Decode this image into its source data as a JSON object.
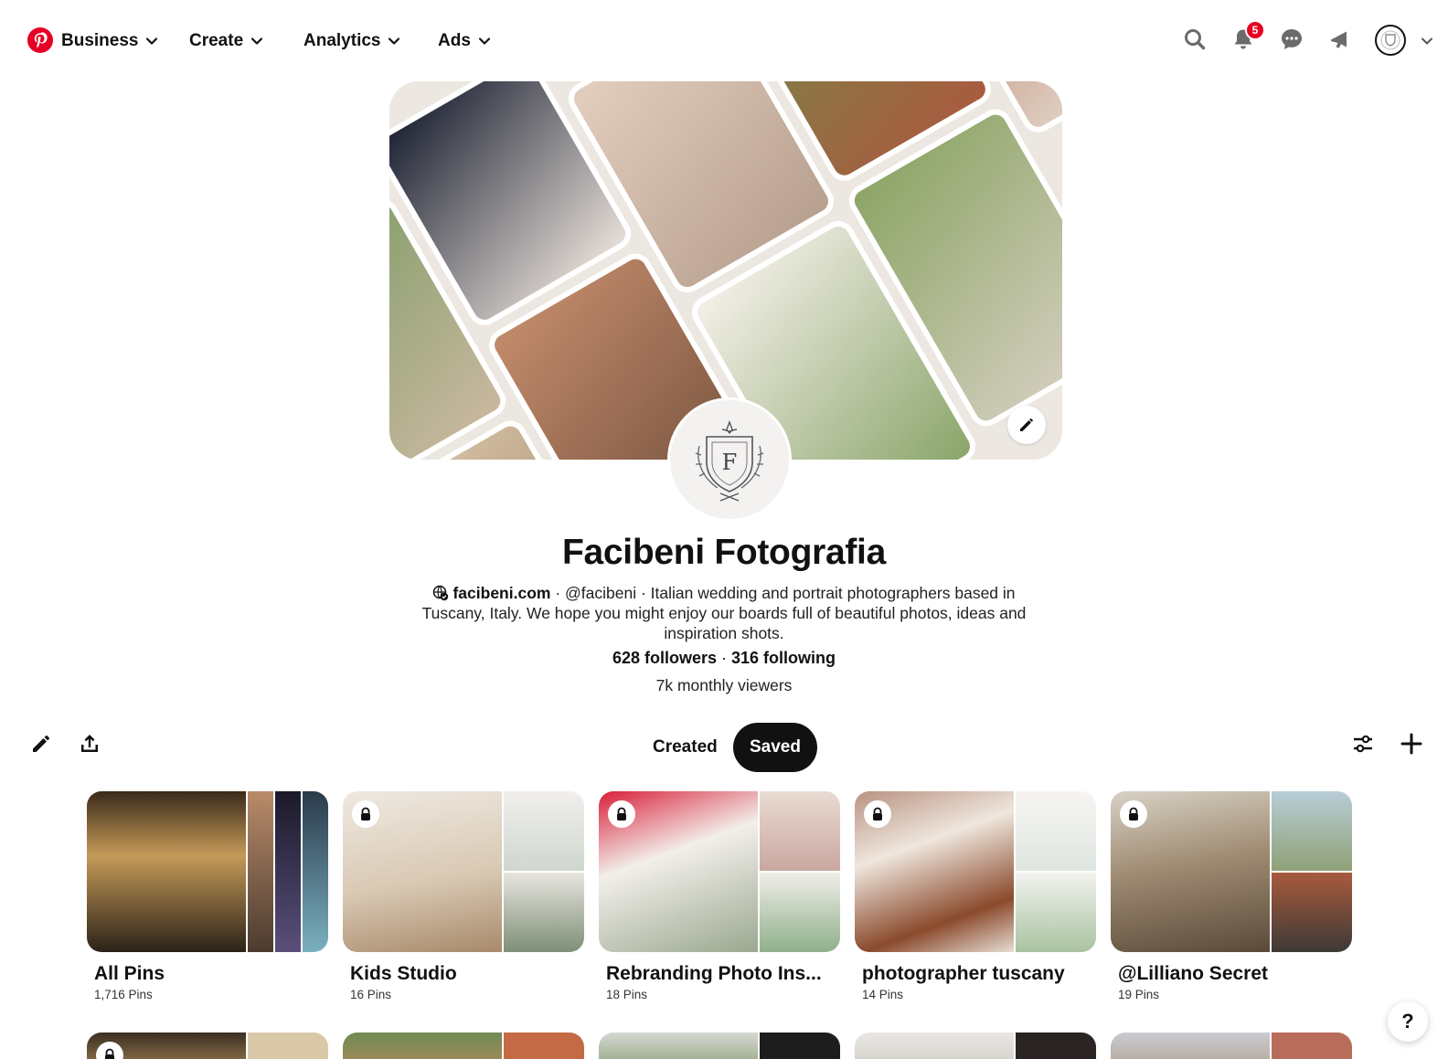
{
  "nav": {
    "items": [
      {
        "label": "Business"
      },
      {
        "label": "Create"
      },
      {
        "label": "Analytics"
      },
      {
        "label": "Ads"
      }
    ],
    "notification_count": "5",
    "brand_color": "#e60023"
  },
  "profile": {
    "name": "Facibeni Fotografia",
    "website": "facibeni.com",
    "bio_rest": " · @facibeni · Italian wedding and portrait photographers based in Tuscany, Italy. We hope you might enjoy our boards full of beautiful photos, ideas and inspiration shots.",
    "followers": "628 followers",
    "following": "316 following",
    "separator": " · ",
    "monthly_viewers": "7k monthly viewers",
    "avatar_letter": "F"
  },
  "tabs": {
    "created": "Created",
    "saved": "Saved",
    "active": "Saved"
  },
  "boards": [
    {
      "title": "All Pins",
      "count": "1,716 Pins",
      "locked": false
    },
    {
      "title": "Kids Studio",
      "count": "16 Pins",
      "locked": true
    },
    {
      "title": "Rebranding Photo Ins...",
      "count": "18 Pins",
      "locked": true
    },
    {
      "title": "photographer tuscany",
      "count": "14 Pins",
      "locked": true
    },
    {
      "title": "@Lilliano Secret",
      "count": "19 Pins",
      "locked": true
    }
  ],
  "help_label": "?"
}
